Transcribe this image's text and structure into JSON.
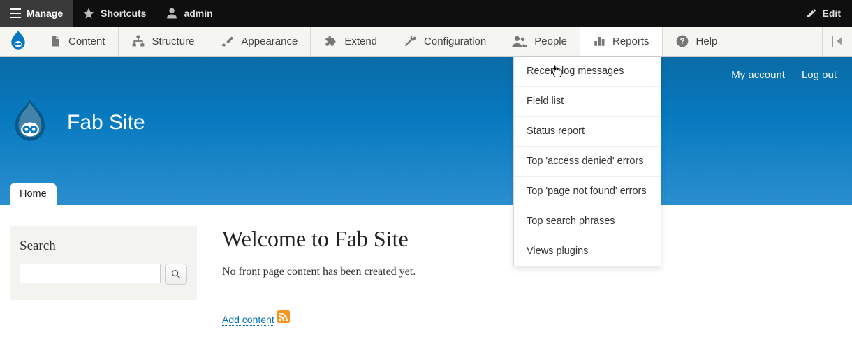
{
  "topbar": {
    "manage": "Manage",
    "shortcuts": "Shortcuts",
    "user": "admin",
    "edit": "Edit"
  },
  "adminmenu": {
    "items": [
      {
        "label": "Content"
      },
      {
        "label": "Structure"
      },
      {
        "label": "Appearance"
      },
      {
        "label": "Extend"
      },
      {
        "label": "Configuration"
      },
      {
        "label": "People"
      },
      {
        "label": "Reports"
      },
      {
        "label": "Help"
      }
    ]
  },
  "reports_dropdown": [
    "Recent log messages",
    "Field list",
    "Status report",
    "Top 'access denied' errors",
    "Top 'page not found' errors",
    "Top search phrases",
    "Views plugins"
  ],
  "userlinks": {
    "account": "My account",
    "logout": "Log out"
  },
  "site": {
    "name": "Fab Site"
  },
  "maintabs": {
    "home": "Home"
  },
  "sidebar": {
    "search_title": "Search"
  },
  "main": {
    "heading": "Welcome to Fab Site",
    "empty": "No front page content has been created yet.",
    "add": "Add content"
  }
}
